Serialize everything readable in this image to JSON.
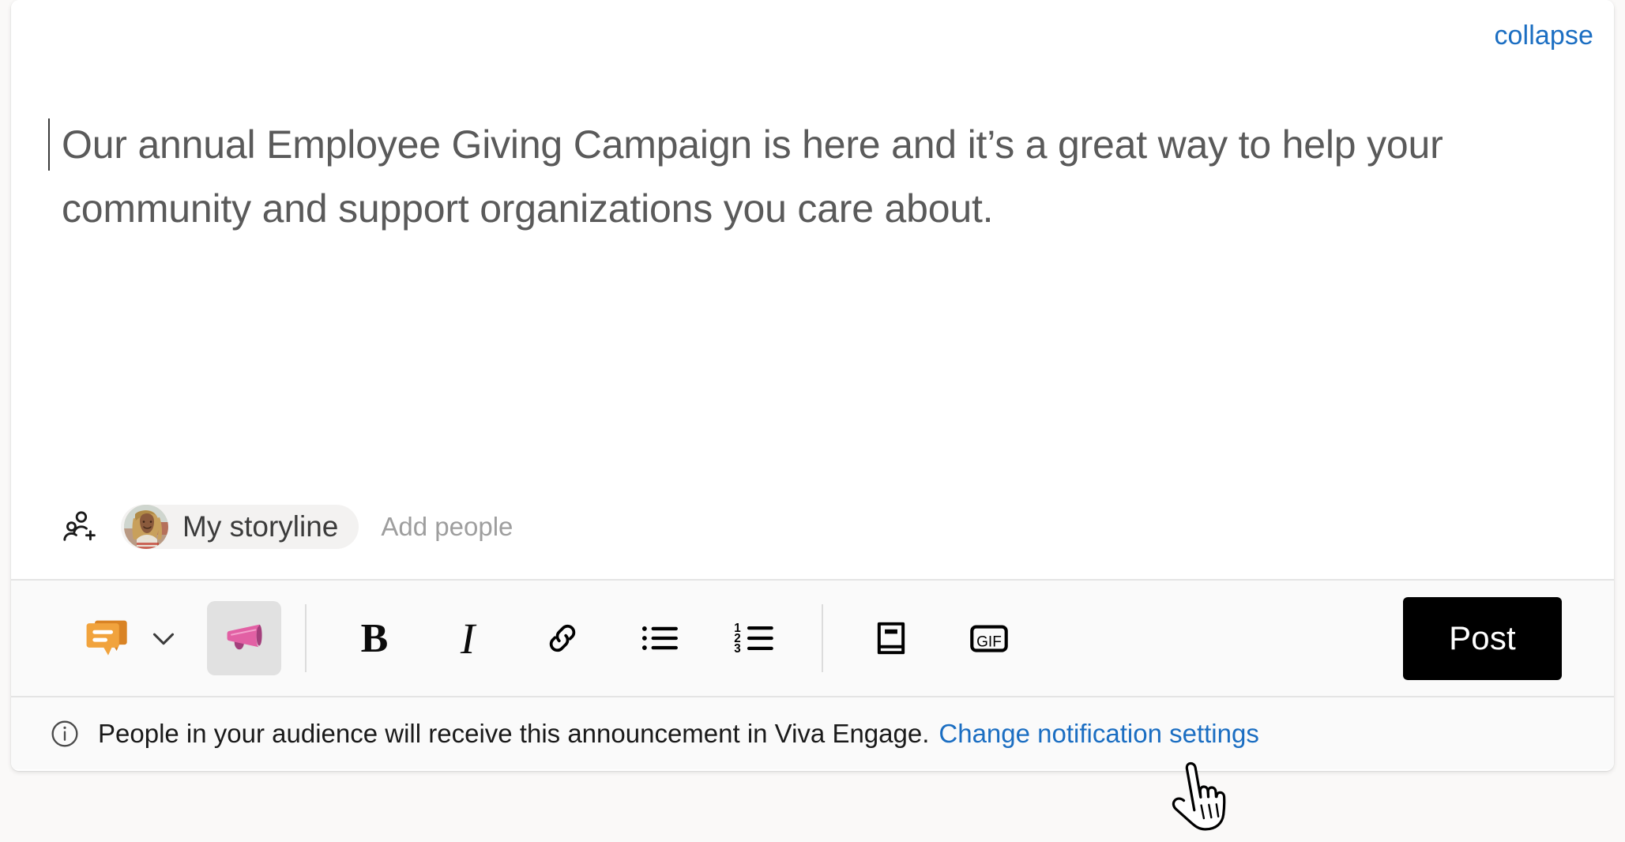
{
  "composer": {
    "collapse_label": "collapse",
    "post_text_line1": "Our annual Employee Giving Campaign is here and it’s a great way to",
    "post_text_line2": "help your community and support organizations you care about.",
    "post_text_full": "Our annual Employee Giving Campaign is here and it’s a great way to help your community and support organizations you care about.",
    "caret_visible": true
  },
  "audience": {
    "icon": "add-people-icon",
    "chip_label": "My storyline",
    "avatar_alt": "user-avatar",
    "add_people_label": "Add people"
  },
  "toolbar": {
    "post_type_icon": "discussion-icon",
    "post_type_chevron_icon": "chevron-down-icon",
    "announcement_icon": "megaphone-icon",
    "announcement_selected": true,
    "bold_label": "B",
    "italic_label": "I",
    "link_icon": "link-icon",
    "bulleted_list_icon": "bulleted-list-icon",
    "numbered_list_icon": "numbered-list-icon",
    "numbered_list_digits": [
      "1",
      "2",
      "3"
    ],
    "article_icon": "book-icon",
    "gif_label": "GIF",
    "post_label": "Post"
  },
  "notice": {
    "info_icon": "info-icon",
    "message": "People in your audience will receive this announcement in Viva Engage.",
    "link_label": "Change notification settings"
  },
  "cursor": {
    "type": "pointing-hand-cursor"
  },
  "colors": {
    "link": "#1b6ec2",
    "post_button_bg": "#000000",
    "card_bg": "#ffffff",
    "toolbar_bg": "#fafafa",
    "page_bg": "#faf9f8",
    "megaphone": "#e260a4",
    "discussion": "#f2a33c",
    "text": "#5a5a5a"
  }
}
